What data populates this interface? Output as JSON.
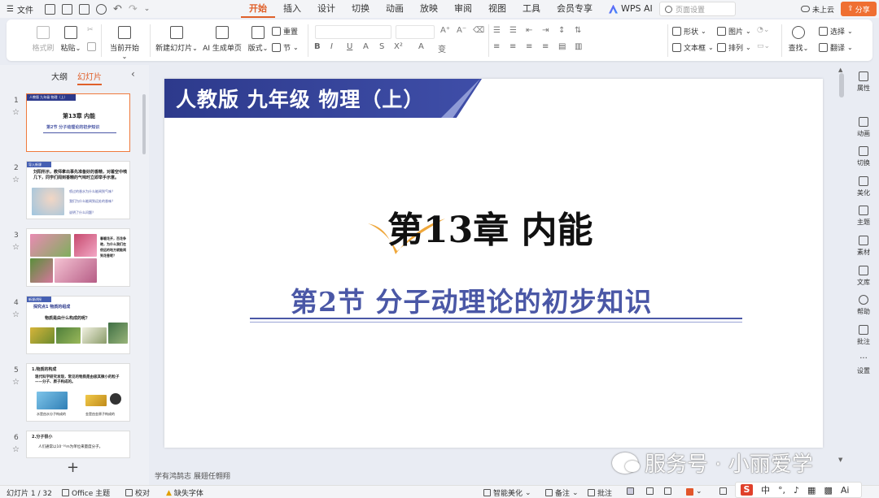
{
  "menubar": {
    "file_label": "文件",
    "tabs": [
      "开始",
      "插入",
      "设计",
      "切换",
      "动画",
      "放映",
      "审阅",
      "视图",
      "工具",
      "会员专享",
      "WPS AI"
    ],
    "active_tab": "开始",
    "search_placeholder": "页面设置",
    "cloud_label": "未上云",
    "share_label": "分享"
  },
  "ribbon": {
    "format_painter": "格式刷",
    "paste": "粘贴",
    "start_from_current": "当前开始",
    "new_slide": "新建幻灯片",
    "ai_single_page": "AI 生成单页",
    "layout": "版式",
    "reset": "重置",
    "section": "节",
    "format_buttons": [
      "B",
      "I",
      "U",
      "A",
      "S",
      "X²",
      "A",
      "变"
    ],
    "shape": "形状",
    "picture": "图片",
    "textbox": "文本框",
    "arrange": "排列",
    "find": "查找",
    "select": "选择",
    "translate": "翻译"
  },
  "leftpanel": {
    "tab_outline": "大纲",
    "tab_slides": "幻灯片",
    "thumbs": [
      {
        "num": "1",
        "title": "人教版 九年级 物理（上）",
        "line1": "第13章 内能",
        "line2": "第2节 分子动理论的初步知识"
      },
      {
        "num": "2",
        "tag": "导入新课",
        "line1": "刘阳所示，教师拿出事先准备好的香精，对着空中喷几下，同学们闻到香精的气味时立即举手示意。",
        "q1": "喷过的香水为什么能闻到气味？",
        "q2": "我们为什么能闻到远处的香味？",
        "q3": "说明了什么问题？"
      },
      {
        "num": "3",
        "line1": "春暖花开，百花争艳，为什么我们在很远的地方就能闻到花香呢？"
      },
      {
        "num": "4",
        "tag": "新课讲授",
        "line1": "探究点1 物质的组成",
        "line2": "物质是由什么构成的呢？"
      },
      {
        "num": "5",
        "line1": "1.物质的构成",
        "line2": "现代科学研究发现，常见的物质是由极其微小的粒子——分子、原子构成的。",
        "cap1": "水是由水分子构成的",
        "cap2": "金是由金原子构成的"
      },
      {
        "num": "6",
        "line1": "2.分子很小",
        "line2": "人们通常以10⁻¹⁰m为单位来量度分子。"
      }
    ]
  },
  "slide": {
    "banner": "人教版 九年级 物理（上）",
    "chapter": "第13章  内能",
    "section": "第2节  分子动理论的初步知识"
  },
  "notes_placeholder": "学有鸿鹄志 展翅任翱翔",
  "rightpanel": [
    "属性",
    "动画",
    "切换",
    "美化",
    "主题",
    "素材",
    "文库",
    "帮助",
    "批注",
    "设置"
  ],
  "statusbar": {
    "slide_counter": "幻灯片 1 / 32",
    "theme": "Office 主题",
    "proofread": "校对",
    "missing_font": "缺失字体",
    "smart_beautify": "智能美化",
    "notes": "备注",
    "comments": "批注"
  },
  "ime": {
    "lang": "中",
    "logo": "S",
    "ai": "Ai"
  },
  "watermark": "服务号 · 小丽爱学",
  "colors": {
    "accent": "#e0602a",
    "banner": "#2d3a8c",
    "section_text": "#4a57a6",
    "share": "#ef6f32"
  }
}
